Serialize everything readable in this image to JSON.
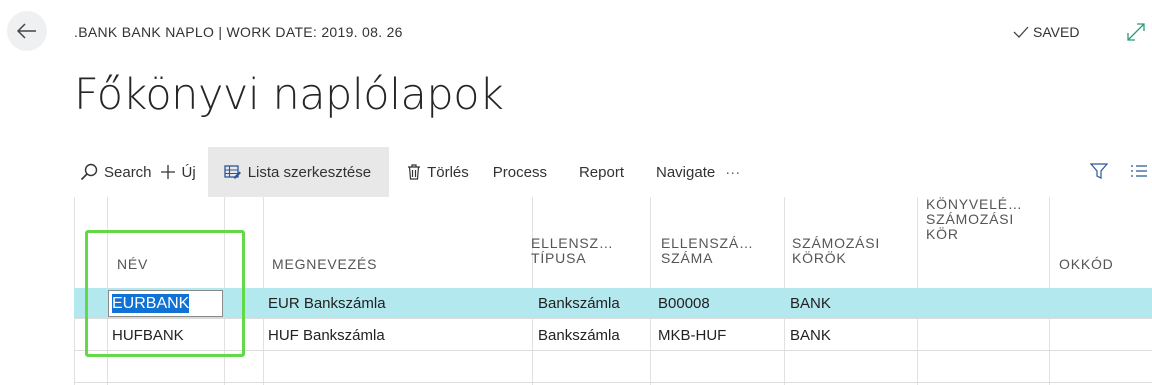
{
  "header": {
    "breadcrumb": ".BANK BANK NAPLO | WORK DATE: 2019. 08. 26",
    "saved_label": "SAVED",
    "page_title": "Főkönyvi naplólapok"
  },
  "actions": {
    "search": "Search",
    "new": "Új",
    "edit_list": "Lista szerkesztése",
    "delete": "Törlés",
    "process": "Process",
    "report": "Report",
    "navigate": "Navigate",
    "more": "···"
  },
  "table": {
    "columns": {
      "name": "NÉV",
      "description": "MEGNEVEZÉS",
      "bal_type_1": "ELLENSZ…",
      "bal_type_2": "TÍPUSA",
      "bal_no_1": "ELLENSZÁ…",
      "bal_no_2": "SZÁMA",
      "no_series_1": "SZÁMOZÁSI",
      "no_series_2": "KÖRÖK",
      "posting_series_1": "KÖNYVELÉ…",
      "posting_series_2": "SZÁMOZÁSI",
      "posting_series_3": "KÖR",
      "reason_code": "OKKÓD"
    },
    "rows": [
      {
        "name": "EURBANK",
        "description": "EUR Bankszámla",
        "bal_type": "Bankszámla",
        "bal_no": "B00008",
        "no_series": "BANK"
      },
      {
        "name": "HUFBANK",
        "description": "HUF Bankszámla",
        "bal_type": "Bankszámla",
        "bal_no": "MKB-HUF",
        "no_series": "BANK"
      }
    ]
  },
  "colors": {
    "selected_row": "#b2e8ee",
    "highlight": "#62d945",
    "text_selection": "#0f72d4"
  }
}
